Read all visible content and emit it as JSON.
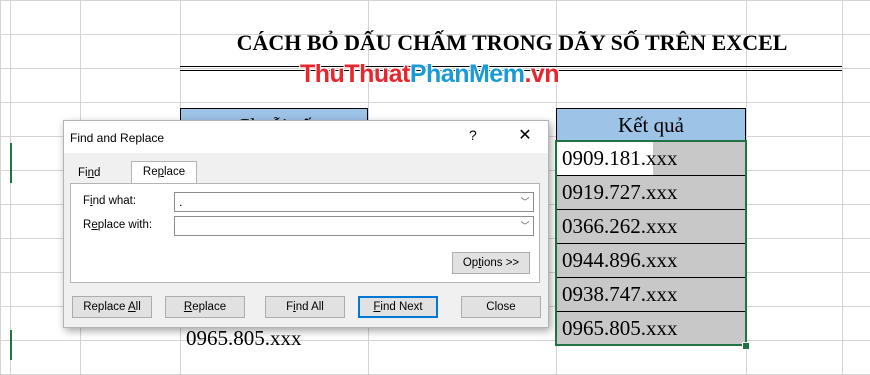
{
  "sheet": {
    "title": "CÁCH BỎ DẤU CHẤM TRONG DÃY SỐ TRÊN EXCEL",
    "watermark_part1": "ThuThuat",
    "watermark_part2": "PhanMem",
    "watermark_part3": ".vn",
    "left_header_peek": "Chuỗi số",
    "result_header": "Kết quả",
    "results": [
      "0909.181.xxx",
      "0919.727.xxx",
      "0366.262.xxx",
      "0944.896.xxx",
      "0938.747.xxx",
      "0965.805.xxx"
    ],
    "peek_value": "0965.805.xxx",
    "colors": {
      "header_fill": "#9dc3e6",
      "selection": "#217346",
      "selected_fill": "#c8c8c8"
    }
  },
  "dialog": {
    "title": "Find and Replace",
    "help": "?",
    "close": "✕",
    "tabs": {
      "find": "Find",
      "replace": "Replace"
    },
    "find_what_label": "Find what:",
    "find_what_value": ".",
    "replace_with_label": "Replace with:",
    "replace_with_value": "",
    "options_button": "Options >>",
    "buttons": {
      "replace_all": "Replace All",
      "replace": "Replace",
      "find_all": "Find All",
      "find_next": "Find Next",
      "close": "Close"
    }
  }
}
